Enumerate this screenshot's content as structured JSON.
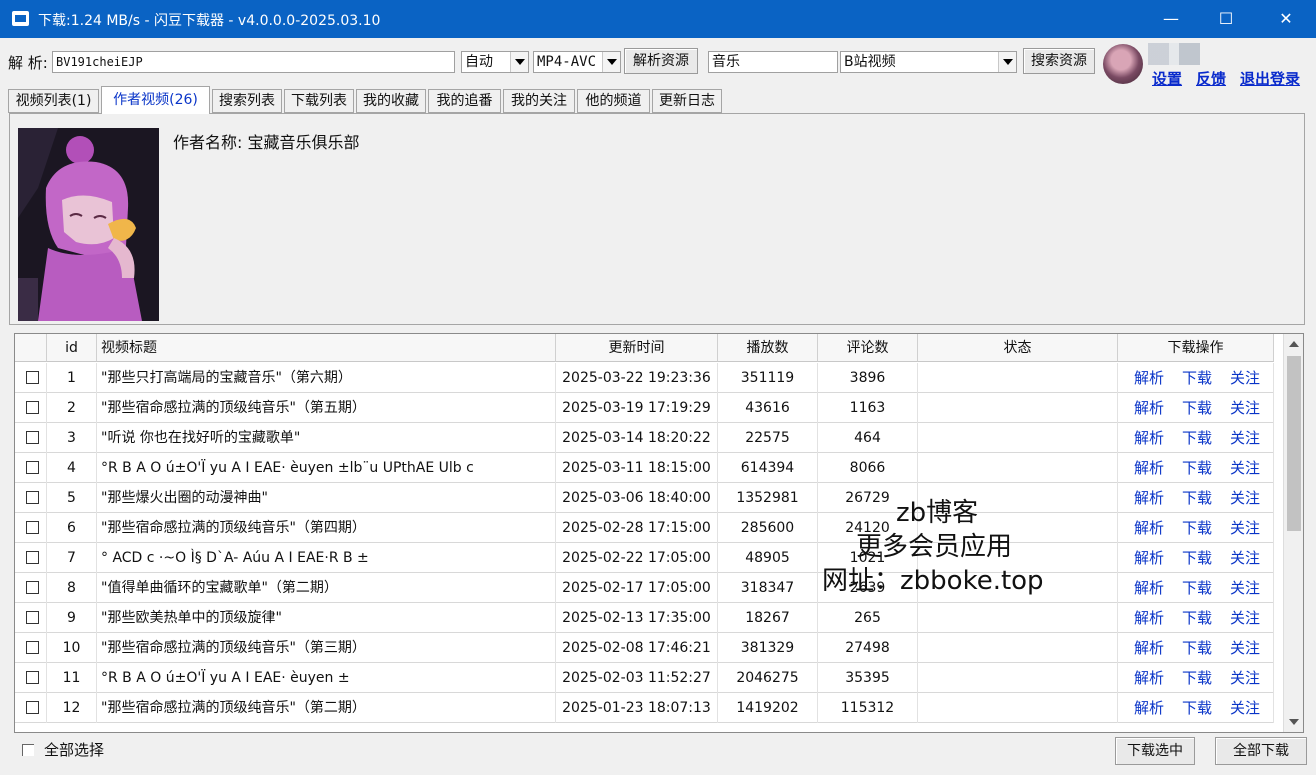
{
  "window": {
    "title": "下载:1.24 MB/s - 闪豆下载器 - v4.0.0.0-2025.03.10",
    "minimize": "—",
    "maximize": "☐",
    "close": "✕"
  },
  "toolbar": {
    "parse_label": "解 析:",
    "bv_value": "BV191cheiEJP",
    "quality_value": "自动",
    "format_value": "MP4-AVC",
    "parse_button": "解析资源",
    "search_value": "音乐",
    "search_source": "B站视频",
    "search_button": "搜索资源",
    "settings_link": "设置",
    "feedback_link": "反馈",
    "logout_link": "退出登录"
  },
  "tabs": [
    {
      "label": "视频列表(1)",
      "active": false
    },
    {
      "label": "作者视频(26)",
      "active": true
    },
    {
      "label": "搜索列表",
      "active": false
    },
    {
      "label": "下载列表",
      "active": false
    },
    {
      "label": "我的收藏",
      "active": false
    },
    {
      "label": "我的追番",
      "active": false
    },
    {
      "label": "我的关注",
      "active": false
    },
    {
      "label": "他的频道",
      "active": false
    },
    {
      "label": "更新日志",
      "active": false
    }
  ],
  "author": {
    "name": "作者名称: 宝藏音乐俱乐部"
  },
  "table": {
    "headers": {
      "id": "id",
      "title": "视频标题",
      "time": "更新时间",
      "plays": "播放数",
      "comments": "评论数",
      "status": "状态",
      "actions": "下载操作"
    },
    "action_labels": {
      "parse": "解析",
      "download": "下载",
      "follow": "关注"
    },
    "rows": [
      {
        "id": "1",
        "title": "\"那些只打高端局的宝藏音乐\"（第六期）",
        "time": "2025-03-22 19:23:36",
        "plays": "351119",
        "comments": "3896",
        "status": ""
      },
      {
        "id": "2",
        "title": "\"那些宿命感拉满的顶级纯音乐\"（第五期）",
        "time": "2025-03-19 17:19:29",
        "plays": "43616",
        "comments": "1163",
        "status": ""
      },
      {
        "id": "3",
        "title": "\"听说 你也在找好听的宝藏歌单\"",
        "time": "2025-03-14 18:20:22",
        "plays": "22575",
        "comments": "464",
        "status": ""
      },
      {
        "id": "4",
        "title": "°R B A O ú±O'Ï yu A I EAE· èuyen ±lb¨u UPthAE Ulb c",
        "time": "2025-03-11 18:15:00",
        "plays": "614394",
        "comments": "8066",
        "status": ""
      },
      {
        "id": "5",
        "title": "\"那些爆火出圈的动漫神曲\"",
        "time": "2025-03-06 18:40:00",
        "plays": "1352981",
        "comments": "26729",
        "status": ""
      },
      {
        "id": "6",
        "title": "\"那些宿命感拉满的顶级纯音乐\"（第四期）",
        "time": "2025-02-28 17:15:00",
        "plays": "285600",
        "comments": "24120",
        "status": ""
      },
      {
        "id": "7",
        "title": "° ACD c ·~O Ì§ D`A- Aúu A I EAE·R B ±",
        "time": "2025-02-22 17:05:00",
        "plays": "48905",
        "comments": "1021",
        "status": ""
      },
      {
        "id": "8",
        "title": "\"值得单曲循环的宝藏歌单\"（第二期）",
        "time": "2025-02-17 17:05:00",
        "plays": "318347",
        "comments": "2639",
        "status": ""
      },
      {
        "id": "9",
        "title": "\"那些欧美热单中的顶级旋律\"",
        "time": "2025-02-13 17:35:00",
        "plays": "18267",
        "comments": "265",
        "status": ""
      },
      {
        "id": "10",
        "title": "\"那些宿命感拉满的顶级纯音乐\"（第三期）",
        "time": "2025-02-08 17:46:21",
        "plays": "381329",
        "comments": "27498",
        "status": ""
      },
      {
        "id": "11",
        "title": "°R B A O ú±O'Ï yu A I EAE· èuyen ±",
        "time": "2025-02-03 11:52:27",
        "plays": "2046275",
        "comments": "35395",
        "status": ""
      },
      {
        "id": "12",
        "title": "\"那些宿命感拉满的顶级纯音乐\"（第二期）",
        "time": "2025-01-23 18:07:13",
        "plays": "1419202",
        "comments": "115312",
        "status": ""
      }
    ]
  },
  "watermark": {
    "line1": "zb博客",
    "line2": "更多会员应用",
    "line3": "网址：zbboke.top"
  },
  "footer": {
    "select_all": "全部选择",
    "download_selected": "下载选中",
    "download_all": "全部下载"
  }
}
